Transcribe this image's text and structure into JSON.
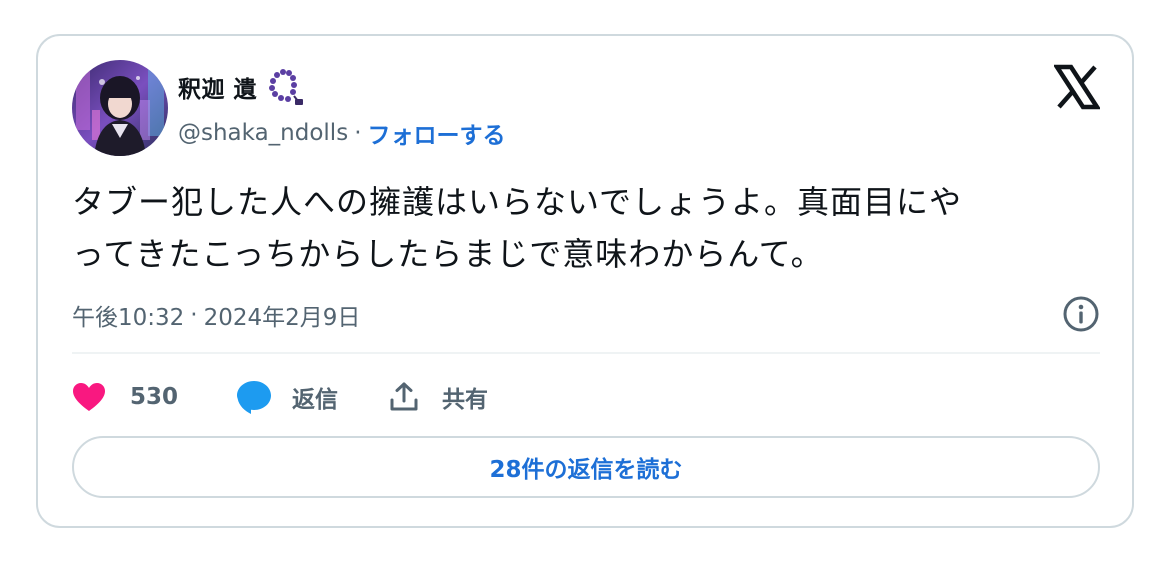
{
  "user": {
    "display_name": "釈迦 遺",
    "handle": "@shaka_ndolls",
    "separator": "·",
    "follow_label": "フォローする"
  },
  "tweet": {
    "text_line1": "タブー犯した人への擁護はいらないでしょうよ。真面目にや",
    "text_line2": "ってきたこっちからしたらまじで意味わからんて。",
    "time": "午後10:32",
    "time_separator": "·",
    "date": "2024年2月9日"
  },
  "actions": {
    "like_count": "530",
    "reply_label": "返信",
    "share_label": "共有"
  },
  "read_replies_label": "28件の返信を読む",
  "colors": {
    "like_pink": "#f91880",
    "reply_blue": "#1d9bf0",
    "link_blue": "#1d6fd6",
    "muted_text": "#536471",
    "border": "#cfd9de",
    "beads_purple": "#5b3fa3"
  },
  "icons": {
    "logo": "x-logo-icon",
    "info": "info-icon",
    "like": "heart-icon",
    "reply": "speech-bubble-icon",
    "share": "share-icon",
    "name_emoji": "prayer-beads-icon"
  }
}
